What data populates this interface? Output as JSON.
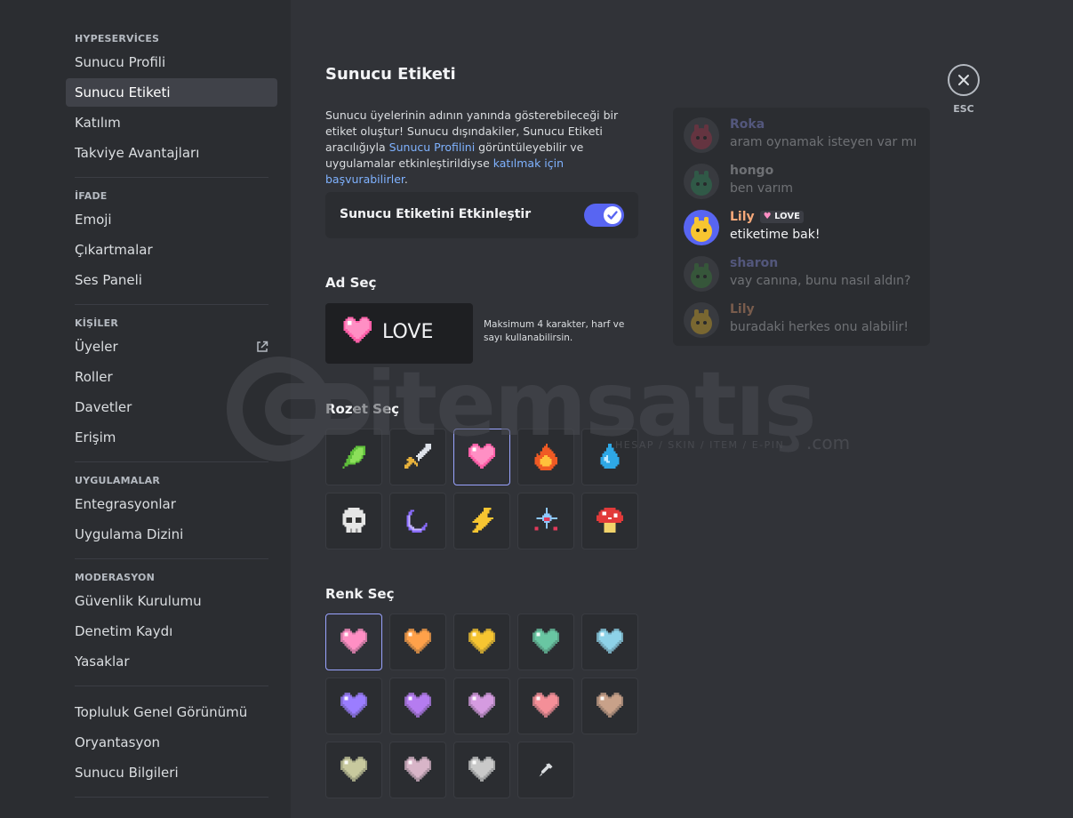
{
  "sidebar": {
    "sections": [
      {
        "title": "HYPESERVİCES",
        "items": [
          "Sunucu Profili",
          "Sunucu Etiketi",
          "Katılım",
          "Takviye Avantajları"
        ]
      },
      {
        "title": "İFADE",
        "items": [
          "Emoji",
          "Çıkartmalar",
          "Ses Paneli"
        ]
      },
      {
        "title": "KİŞİLER",
        "items": [
          "Üyeler",
          "Roller",
          "Davetler",
          "Erişim"
        ]
      },
      {
        "title": "UYGULAMALAR",
        "items": [
          "Entegrasyonlar",
          "Uygulama Dizini"
        ]
      },
      {
        "title": "MODERASYON",
        "items": [
          "Güvenlik Kurulumu",
          "Denetim Kaydı",
          "Yasaklar"
        ]
      },
      {
        "title": "",
        "items": [
          "Topluluk Genel Görünümü",
          "Oryantasyon",
          "Sunucu Bilgileri"
        ]
      }
    ],
    "active_item": "Sunucu Etiketi"
  },
  "main": {
    "title": "Sunucu Etiketi",
    "desc_part1": "Sunucu üyelerinin adının yanında gösterebileceği bir etiket oluştur! Sunucu dışındakiler, Sunucu Etiketi aracılığıyla ",
    "desc_link1": "Sunucu Profilini",
    "desc_part2": " görüntüleyebilir ve uygulamalar etkinleştirildiyse ",
    "desc_link2": "katılmak için başvurabilirler",
    "desc_part3": ".",
    "toggle_label": "Sunucu Etiketini Etkinleştir",
    "toggle_on": true,
    "name_heading": "Ad Seç",
    "name_value": "LOVE",
    "name_hint": "Maksimum 4 karakter, harf ve sayı kullanabilirsin.",
    "badge_heading": "Rozet Seç",
    "badges": [
      "leaf-icon",
      "sword-icon",
      "heart-icon",
      "fire-icon",
      "water-drop-icon",
      "skull-icon",
      "moon-icon",
      "lightning-icon",
      "crystal-icon",
      "mushroom-icon"
    ],
    "selected_badge": 2,
    "color_heading": "Renk Seç",
    "colors": [
      "#ff8fc4",
      "#ffa14a",
      "#f7c531",
      "#69c6a2",
      "#8ed2e8",
      "#9b7dff",
      "#b57cf0",
      "#d59be0",
      "#f48f98",
      "#c8a189",
      "#c8c99e",
      "#d8b5c8",
      "#c9c9c9"
    ],
    "selected_color": 0,
    "eyedropper_icon": "eyedropper-icon"
  },
  "preview": {
    "messages": [
      {
        "user": "Roka",
        "text": "aram oynamak isteyen var mı",
        "user_color": "#949cf7",
        "dim": true
      },
      {
        "user": "hongo",
        "text": "ben varım",
        "user_color": "#dbdee1",
        "dim": true
      },
      {
        "user": "Lily",
        "text": "etiketime bak!",
        "user_color": "#f7a97a",
        "dim": false,
        "tag": "LOVE"
      },
      {
        "user": "sharon",
        "text": "vay canına, bunu nasıl aldın?",
        "user_color": "#949cf7",
        "dim": true
      },
      {
        "user": "Lily",
        "text": "buradaki herkes onu alabilir!",
        "user_color": "#f7a97a",
        "dim": true
      }
    ]
  },
  "close": {
    "label": "ESC"
  },
  "watermark": {
    "text": "itemsatış",
    "sub": "HESAP / SKIN / ITEM / E-PIN",
    "com": ".com"
  }
}
